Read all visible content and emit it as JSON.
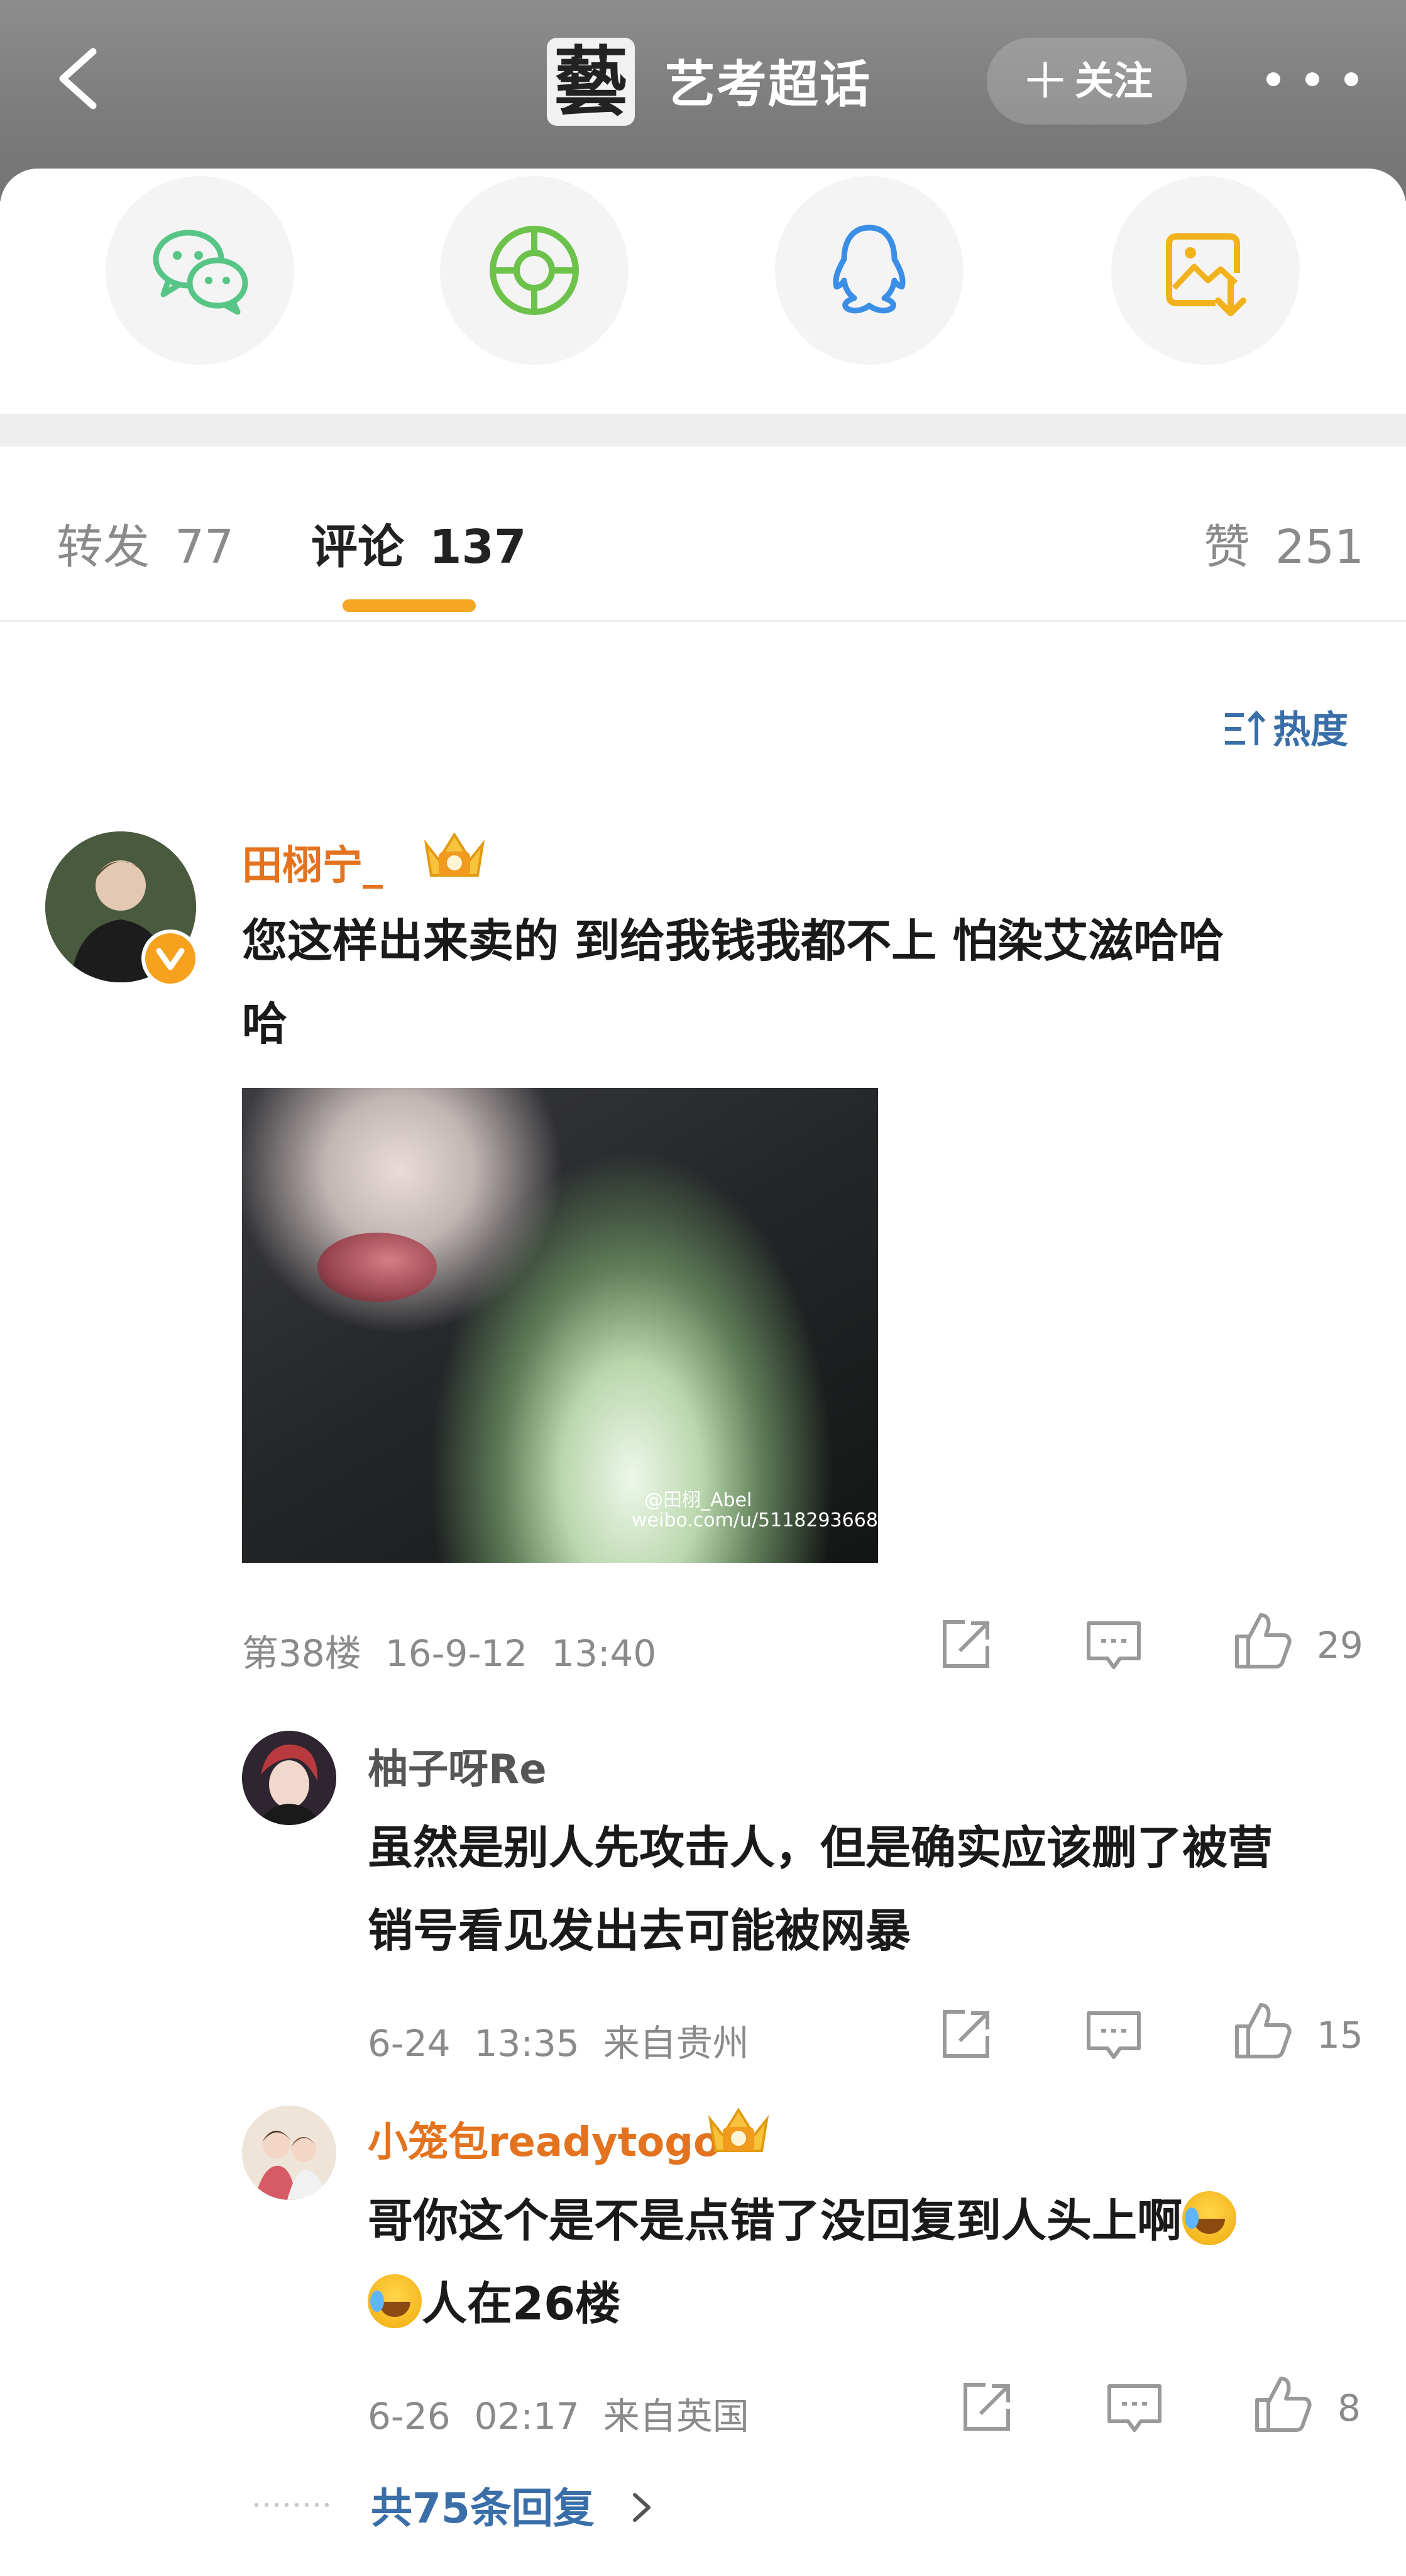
{
  "header": {
    "logo_char": "藝",
    "title": "艺考超话",
    "follow_label": "关注"
  },
  "tabs": {
    "repost_label": "转发",
    "repost_count": "77",
    "comment_label": "评论",
    "comment_count": "137",
    "like_label": "赞",
    "like_count": "251"
  },
  "sort": {
    "label": "热度",
    "icon": "sort-icon"
  },
  "comments": [
    {
      "username": "田栩宁_",
      "text_line1": "您这样出来卖的 到给我钱我都不上 怕染艾滋哈哈",
      "text_line2": "哈",
      "floor": "第38楼",
      "date": "16-9-12",
      "time": "13:40",
      "likes": "29",
      "image_watermark_handle": "@田栩_Abel",
      "image_watermark_url": "weibo.com/u/5118293668"
    },
    {
      "username": "柚子呀Re",
      "text_line1": "虽然是别人先攻击人，但是确实应该删了被营",
      "text_line2": "销号看见发出去可能被网暴",
      "date": "6-24",
      "time": "13:35",
      "location": "来自贵州",
      "likes": "15"
    },
    {
      "username": "小笼包readytogo",
      "text_line1": "哥你这个是不是点错了没回复到人头上啊",
      "text_line2": "人在26楼",
      "date": "6-26",
      "time": "02:17",
      "location": "来自英国",
      "likes": "8"
    }
  ],
  "more_replies": "共75条回复",
  "colors": {
    "accent": "#f5a623",
    "username_highlight": "#e3731f",
    "link_blue": "#3a6ea8",
    "wechat": "#57c586",
    "moments": "#6cc24a",
    "qq": "#3a8ee6",
    "save": "#f2b21b"
  }
}
